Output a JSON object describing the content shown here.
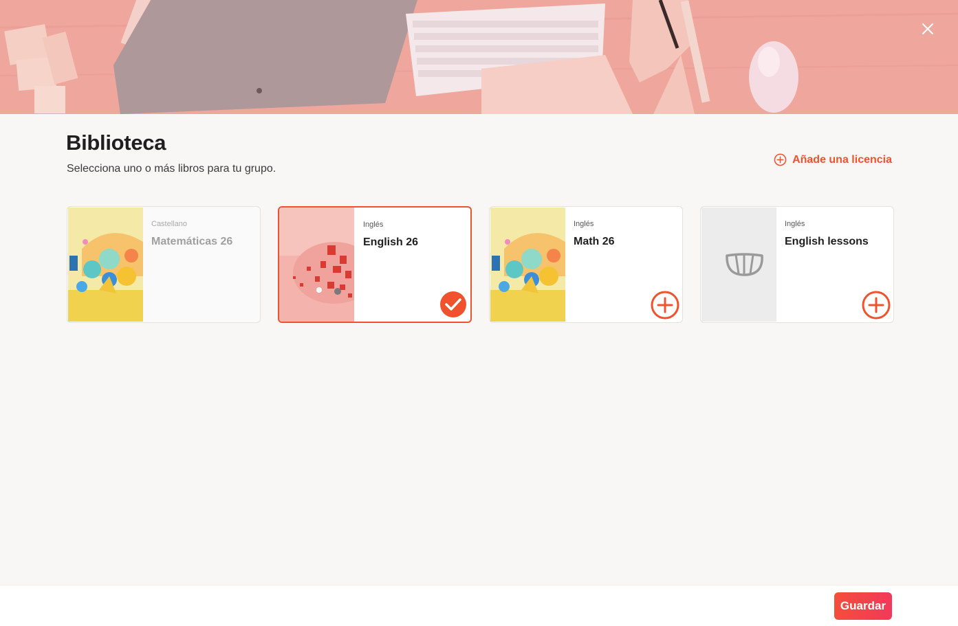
{
  "header": {
    "close_icon": "close-icon"
  },
  "main": {
    "title": "Biblioteca",
    "subtitle": "Selecciona uno o más libros para tu grupo.",
    "add_license_label": "Añade una licencia"
  },
  "books": [
    {
      "subject": "Castellano",
      "name": "Matemáticas 26",
      "state": "disabled",
      "cover": "colorful-spheres-yellow"
    },
    {
      "subject": "Inglés",
      "name": "English 26",
      "state": "selected",
      "cover": "red-letters-pink"
    },
    {
      "subject": "Inglés",
      "name": "Math 26",
      "state": "available",
      "cover": "colorful-spheres-yellow"
    },
    {
      "subject": "Inglés",
      "name": "English lessons",
      "state": "available",
      "cover": "placeholder-logo"
    }
  ],
  "footer": {
    "save_label": "Guardar"
  },
  "colors": {
    "accent": "#f0522d",
    "button_gradient_start": "#f44e3b",
    "button_gradient_end": "#f2395a",
    "background": "#f8f7f6"
  }
}
